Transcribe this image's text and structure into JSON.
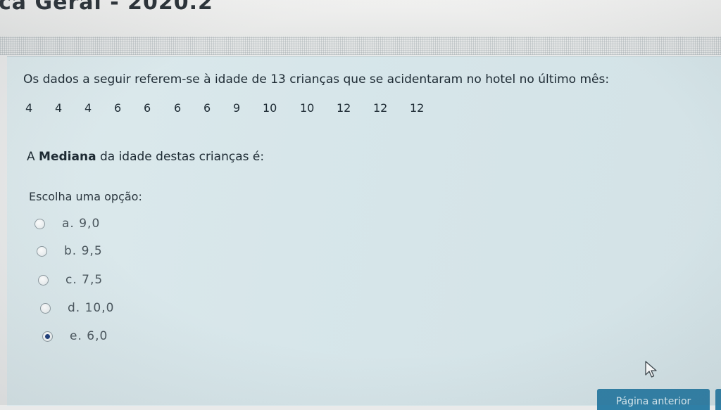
{
  "header": {
    "title": "ca Geral - 2020.2"
  },
  "question": {
    "text": "Os dados a seguir referem-se à idade de 13 crianças que se acidentaram no hotel no último mês:",
    "ages": [
      "4",
      "4",
      "4",
      "6",
      "6",
      "6",
      "6",
      "9",
      "10",
      "10",
      "12",
      "12",
      "12"
    ],
    "median_prefix": "A ",
    "median_bold": "Mediana",
    "median_suffix": " da idade destas crianças é:",
    "choose_label": "Escolha uma opção:"
  },
  "options": [
    {
      "label": "a. 9,0",
      "checked": false
    },
    {
      "label": "b. 9,5",
      "checked": false
    },
    {
      "label": "c. 7,5",
      "checked": false
    },
    {
      "label": "d. 10,0",
      "checked": false
    },
    {
      "label": "e. 6,0",
      "checked": true
    }
  ],
  "navigation": {
    "prev_label": "Página anterior"
  },
  "colors": {
    "panel_background": "#d7e6ea",
    "button_background": "#2f7fa6",
    "radio_selected": "#1e3e7a"
  },
  "icons": {
    "cursor": "mouse-pointer-icon",
    "radio": "radio-button-icon"
  }
}
